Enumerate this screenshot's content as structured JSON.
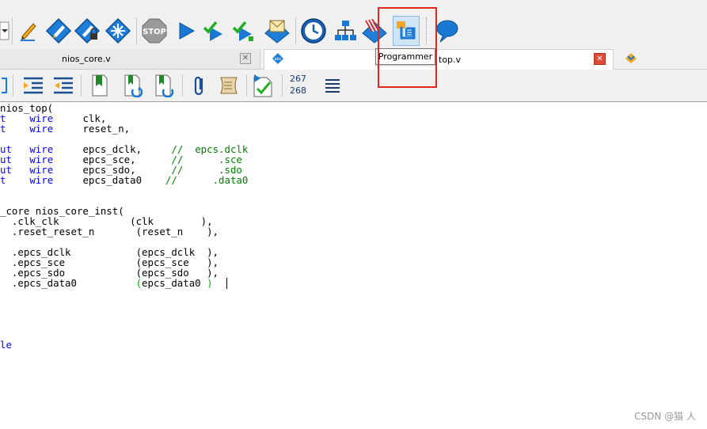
{
  "toolbar": {
    "items": [
      {
        "id": "dropdown-arrow",
        "icon": "dropdown-arrow-icon"
      },
      {
        "id": "pencil",
        "icon": "pencil-icon"
      },
      {
        "id": "edit-diamond",
        "icon": "edit-diamond-icon"
      },
      {
        "id": "edit-diamond-lock",
        "icon": "edit-diamond-lock-icon"
      },
      {
        "id": "cross-diamond",
        "icon": "cross-diamond-icon"
      },
      {
        "id": "stop",
        "icon": "stop-icon",
        "label": "STOP"
      },
      {
        "id": "start-compilation",
        "icon": "play-icon"
      },
      {
        "id": "analysis",
        "icon": "check-play-icon"
      },
      {
        "id": "fitter",
        "icon": "check-play-green-icon"
      },
      {
        "id": "assembler",
        "icon": "envelope-diamond-icon"
      },
      {
        "id": "timing",
        "icon": "clock-icon"
      },
      {
        "id": "netlist",
        "icon": "hierarchy-icon"
      },
      {
        "id": "rtl-viewer",
        "icon": "striped-diamond-icon"
      },
      {
        "id": "programmer",
        "icon": "programmer-icon"
      },
      {
        "id": "help",
        "icon": "speech-bubble-icon"
      }
    ],
    "tooltip": "Programmer"
  },
  "tabs": [
    {
      "label": "nios_core.v",
      "active": false
    },
    {
      "label": "top.v",
      "active": true
    }
  ],
  "tab_icons": {
    "abc": "abc"
  },
  "toolbar2": {
    "line_numbers_top": "267",
    "line_numbers_bottom": "268"
  },
  "code": {
    "lines": [
      {
        "parts": [
          {
            "t": "nios_top(",
            "c": "id"
          }
        ]
      },
      {
        "parts": [
          {
            "t": "t    ",
            "c": "kw"
          },
          {
            "t": "wire",
            "c": "kw"
          },
          {
            "t": "     clk,",
            "c": "id"
          }
        ]
      },
      {
        "parts": [
          {
            "t": "t    ",
            "c": "kw"
          },
          {
            "t": "wire",
            "c": "kw"
          },
          {
            "t": "     reset_n,",
            "c": "id"
          }
        ]
      },
      {
        "parts": []
      },
      {
        "parts": [
          {
            "t": "ut   ",
            "c": "kw"
          },
          {
            "t": "wire",
            "c": "kw"
          },
          {
            "t": "     epcs_dclk,     ",
            "c": "id"
          },
          {
            "t": "//  epcs.dclk",
            "c": "cm"
          }
        ]
      },
      {
        "parts": [
          {
            "t": "ut   ",
            "c": "kw"
          },
          {
            "t": "wire",
            "c": "kw"
          },
          {
            "t": "     epcs_sce,      ",
            "c": "id"
          },
          {
            "t": "//      .sce",
            "c": "cm"
          }
        ]
      },
      {
        "parts": [
          {
            "t": "ut   ",
            "c": "kw"
          },
          {
            "t": "wire",
            "c": "kw"
          },
          {
            "t": "     epcs_sdo,      ",
            "c": "id"
          },
          {
            "t": "//      .sdo",
            "c": "cm"
          }
        ]
      },
      {
        "parts": [
          {
            "t": "t    ",
            "c": "kw"
          },
          {
            "t": "wire",
            "c": "kw"
          },
          {
            "t": "     epcs_data0    ",
            "c": "id"
          },
          {
            "t": "//      .data0",
            "c": "cm"
          }
        ]
      },
      {
        "parts": []
      },
      {
        "parts": []
      },
      {
        "parts": [
          {
            "t": "_core nios_core_inst(",
            "c": "id"
          }
        ]
      },
      {
        "parts": [
          {
            "t": "  .clk_clk            (clk        ),",
            "c": "id"
          }
        ]
      },
      {
        "parts": [
          {
            "t": "  .reset_reset_n       (reset_n    ),",
            "c": "id"
          }
        ]
      },
      {
        "parts": []
      },
      {
        "parts": [
          {
            "t": "  .epcs_dclk           (epcs_dclk  ),",
            "c": "id"
          }
        ]
      },
      {
        "parts": [
          {
            "t": "  .epcs_sce            (epcs_sce   ),",
            "c": "id"
          }
        ]
      },
      {
        "parts": [
          {
            "t": "  .epcs_sdo            (epcs_sdo   ),",
            "c": "id"
          }
        ]
      },
      {
        "parts": [
          {
            "t": "  .epcs_data0          ",
            "c": "id"
          },
          {
            "t": "(",
            "c": "par"
          },
          {
            "t": "epcs_data0 ",
            "c": "id"
          },
          {
            "t": ")",
            "c": "par"
          }
        ]
      },
      {
        "parts": []
      },
      {
        "parts": []
      },
      {
        "parts": []
      },
      {
        "parts": []
      },
      {
        "parts": []
      },
      {
        "parts": [
          {
            "t": "le",
            "c": "kw"
          }
        ]
      }
    ]
  },
  "watermark": "CSDN @猫 人",
  "colors": {
    "keyword": "#0000ff",
    "comment": "#008000",
    "highlight_box": "#e0281e"
  }
}
